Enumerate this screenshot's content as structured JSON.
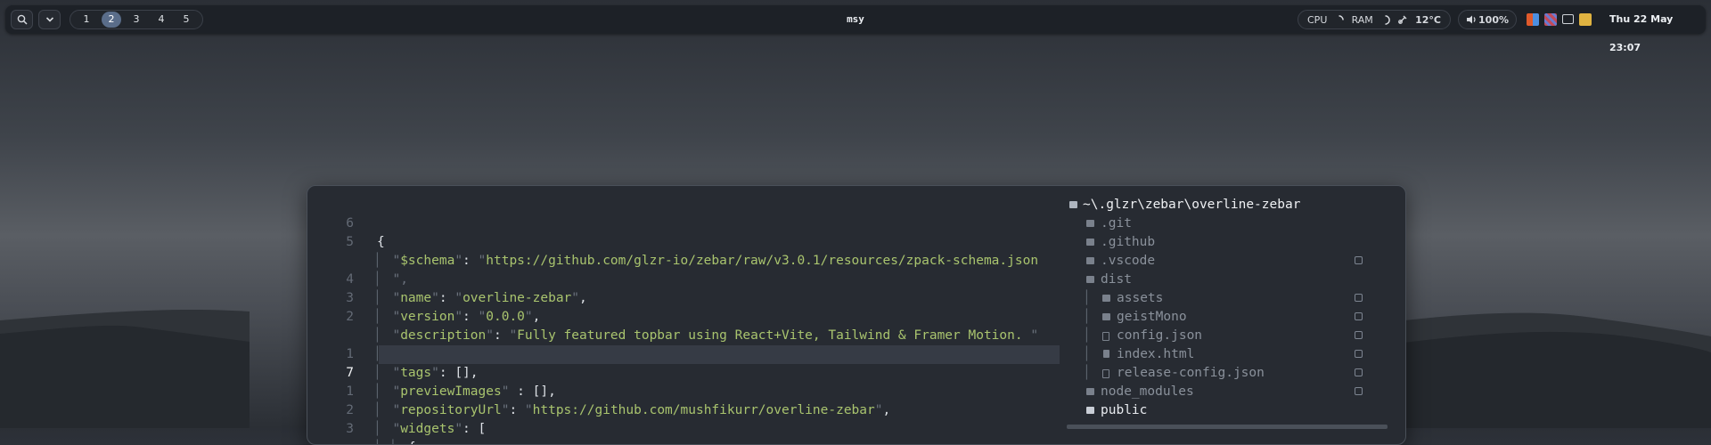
{
  "topbar": {
    "title": "msy",
    "workspaces": [
      "1",
      "2",
      "3",
      "4",
      "5"
    ],
    "active_workspace": "2",
    "system": {
      "cpu_label": "CPU",
      "ram_label": "RAM",
      "temperature": "12°C"
    },
    "volume": "100%",
    "clock": "Thu 22 May 23:07",
    "icons": [
      "search-icon",
      "chevron-down-icon",
      "cpu-spinner-icon",
      "ram-spinner-icon",
      "temperature-icon",
      "speaker-icon"
    ],
    "tray_colors": [
      "#e05a2b",
      "#c44a5a",
      "#cfd3d8",
      "#e0b341"
    ]
  },
  "editor": {
    "lines": [
      {
        "num": "6",
        "content": "{"
      },
      {
        "num": "5",
        "key": "$schema",
        "value": "https://github.com/glzr-io/zebar/raw/v3.0.1/resources/zpack-schema.json"
      },
      {
        "num": "",
        "content": "\","
      },
      {
        "num": "4",
        "key": "name",
        "value": "overline-zebar",
        "trail": ","
      },
      {
        "num": "3",
        "key": "version",
        "value": "0.0.0",
        "trail": ","
      },
      {
        "num": "2",
        "key": "description",
        "value": "Fully featured topbar using React+Vite, Tailwind & Framer Motion. "
      },
      {
        "num": "",
        "content": "\","
      },
      {
        "num": "1",
        "key": "tags",
        "plain": ": [],"
      },
      {
        "num": "7",
        "key": "previewImages",
        "plain": " : [],",
        "current": true
      },
      {
        "num": "1",
        "key": "repositoryUrl",
        "value": "https://github.com/mushfikurr/overline-zebar",
        "trail": ","
      },
      {
        "num": "2",
        "key": "widgets",
        "plain": ": ["
      },
      {
        "num": "3",
        "content": "{"
      }
    ],
    "tree": {
      "root": "~\\.glzr\\zebar\\overline-zebar",
      "items": [
        {
          "name": ".git",
          "depth": 1,
          "type": "folder",
          "dim": true,
          "check": false
        },
        {
          "name": ".github",
          "depth": 1,
          "type": "folder",
          "dim": true,
          "check": false
        },
        {
          "name": ".vscode",
          "depth": 1,
          "type": "folder",
          "dim": true,
          "check": true
        },
        {
          "name": "dist",
          "depth": 1,
          "type": "folder",
          "dim": true,
          "check": false
        },
        {
          "name": "assets",
          "depth": 2,
          "type": "folder",
          "dim": true,
          "check": true
        },
        {
          "name": "geistMono",
          "depth": 2,
          "type": "folder",
          "dim": true,
          "check": true
        },
        {
          "name": "config.json",
          "depth": 2,
          "type": "json",
          "dim": true,
          "check": true
        },
        {
          "name": "index.html",
          "depth": 2,
          "type": "html",
          "dim": true,
          "check": true
        },
        {
          "name": "release-config.json",
          "depth": 2,
          "type": "json",
          "dim": true,
          "check": true
        },
        {
          "name": "node_modules",
          "depth": 1,
          "type": "folder",
          "dim": true,
          "check": true
        },
        {
          "name": "public",
          "depth": 1,
          "type": "folder",
          "dim": false,
          "check": false
        }
      ]
    }
  }
}
